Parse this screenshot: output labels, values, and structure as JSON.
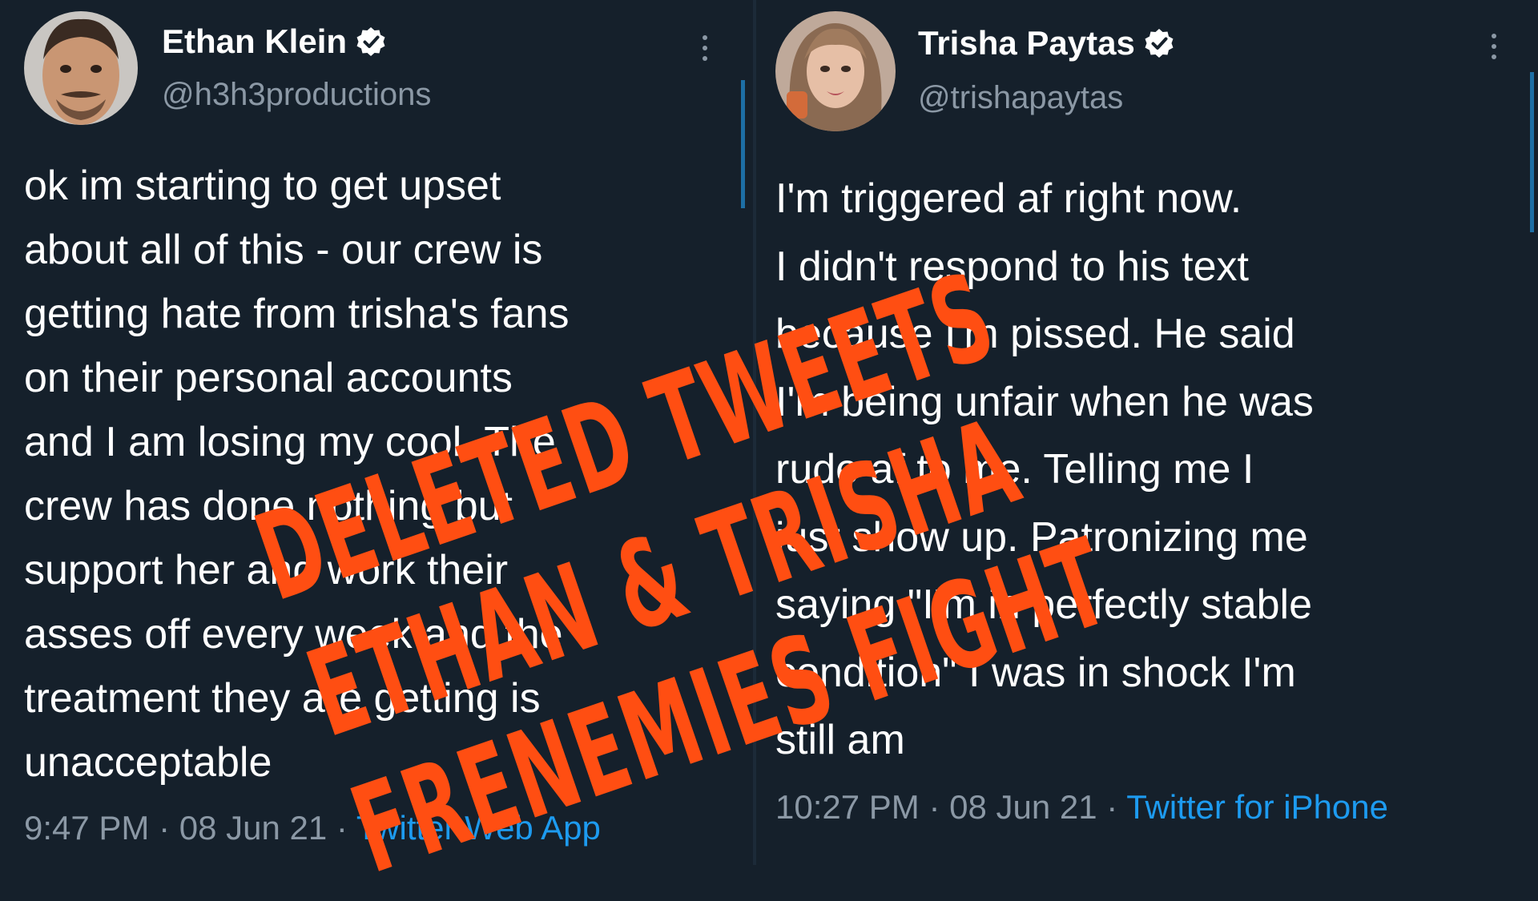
{
  "left_tweet": {
    "display_name": "Ethan Klein",
    "handle": "@h3h3productions",
    "lines": [
      "ok im starting to get upset",
      "about all of this - our crew is",
      "getting hate from trisha's fans",
      "on their personal accounts",
      "and I am losing my cool. The",
      "crew has done nothing but",
      "support her and work their",
      "asses off every week and the",
      "treatment they are getting is",
      "unacceptable"
    ],
    "time": "9:47 PM",
    "date": "08 Jun 21",
    "source": "Twitter Web App"
  },
  "right_tweet": {
    "display_name": "Trisha Paytas",
    "handle": "@trishapaytas",
    "lines": [
      "I'm triggered af right now.",
      "I didn't respond to his text",
      "because I'm pissed. He said",
      "I'm being unfair when he was",
      "rude af to me. Telling me I",
      "just show up. Patronizing me",
      "saying \"I'm in perfectly stable",
      "condition\" I was in shock I'm",
      "still am"
    ],
    "time": "10:27 PM",
    "date": "08 Jun 21",
    "source": "Twitter for iPhone"
  },
  "overlay_text": {
    "line1": "DELETED TWEETS",
    "line2": "ETHAN & TRISHA",
    "line3": "FRENEMIES FIGHT"
  },
  "colors": {
    "background": "#15202b",
    "text": "#ffffff",
    "muted": "#8b98a5",
    "link": "#1d9bf0",
    "overlay": "#ff4e12"
  },
  "icons": {
    "verified": "verified-badge-icon",
    "more": "more-options-icon"
  }
}
